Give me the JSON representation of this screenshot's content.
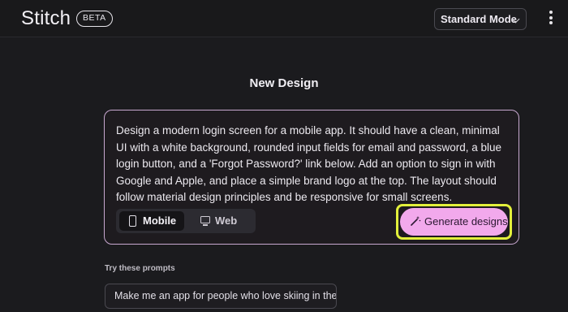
{
  "header": {
    "app_name": "Stitch",
    "badge": "BETA",
    "mode_select": {
      "value": "Standard Mode",
      "icon": "chevron-down-icon"
    },
    "menu_icon": "more-vertical-icon"
  },
  "main": {
    "title": "New Design",
    "prompt": {
      "text": "Design a modern login screen for a mobile app. It should have a clean, minimal UI with a white background, rounded input fields for email and password, a blue login button, and a 'Forgot Password?' link below. Add an option to sign in with Google and Apple, and place a simple brand logo at the top. The layout should follow material design principles and be responsive for small screens."
    },
    "device_toggle": {
      "options": [
        {
          "label": "Mobile",
          "icon": "phone-icon",
          "selected": true
        },
        {
          "label": "Web",
          "icon": "monitor-icon",
          "selected": false
        }
      ]
    },
    "generate_button": {
      "label": "Generate designs",
      "icon": "magic-wand-icon"
    },
    "suggestions": {
      "heading": "Try these prompts",
      "items": [
        "Make me an app for people who love skiing in the Alps"
      ]
    }
  },
  "colors": {
    "background": "#1b1b1e",
    "card_border": "#c8a8d0",
    "generate_button": "#f2a9ec",
    "highlight_outline": "#e2f03b"
  }
}
